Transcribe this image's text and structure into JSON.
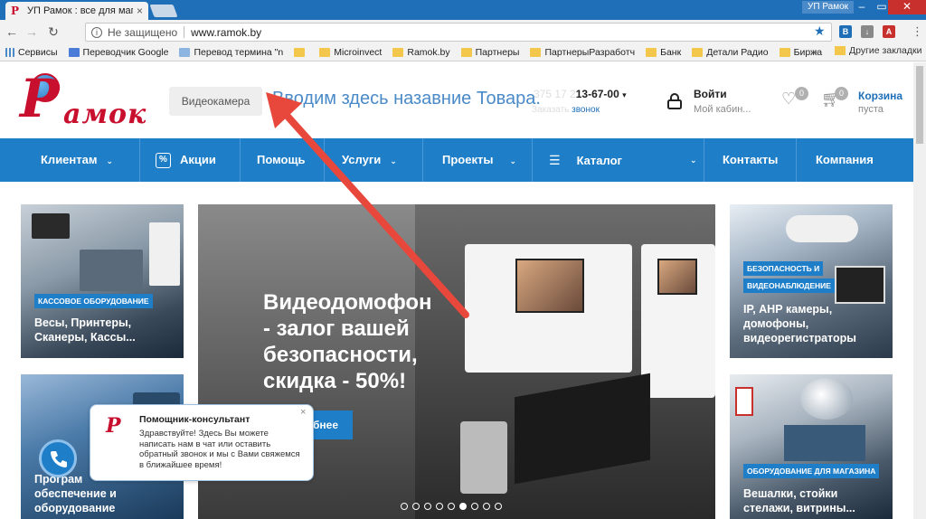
{
  "browser": {
    "tab_title": "УП Рамок : все для магаз",
    "tab_close": "×",
    "user_badge": "УП Рамок",
    "win_min": "‒",
    "win_max": "▭",
    "win_close": "✕",
    "back_icon": "back-arrow-icon",
    "forward_icon": "forward-arrow-icon",
    "reload_icon": "reload-icon",
    "security_label": "Не защищено",
    "url": "www.ramok.by"
  },
  "bookmarks": {
    "items": [
      {
        "label": "Сервисы",
        "icon": "apps-icon"
      },
      {
        "label": "Переводчик Google",
        "icon": "google-translate-icon"
      },
      {
        "label": "Перевод термина \"n",
        "icon": "doc-icon"
      },
      {
        "label": "",
        "icon": "folder-icon"
      },
      {
        "label": "Microinvect",
        "icon": "folder-icon"
      },
      {
        "label": "Ramok.by",
        "icon": "folder-icon"
      },
      {
        "label": "Партнеры",
        "icon": "folder-icon"
      },
      {
        "label": "ПартнерыРазработч",
        "icon": "folder-icon"
      },
      {
        "label": "Банк",
        "icon": "folder-icon"
      },
      {
        "label": "Детали Радио",
        "icon": "folder-icon"
      },
      {
        "label": "Биржа",
        "icon": "folder-icon"
      }
    ],
    "more": "»",
    "other": "Другие закладки"
  },
  "header": {
    "logo_letter": "Р",
    "logo_word": "амок",
    "search_placeholder": "Видеокамера",
    "overlay_text": "Вводим здесь назавние Товара.",
    "phone_prefix": "375 17 2",
    "phone": "13-67-00",
    "phone_chevron": "▾",
    "callback_prefix": "Заказать ",
    "callback": "звонок",
    "login_title": "Войти",
    "login_sub": "Мой кабин...",
    "favorites_count": "0",
    "cart_count": "0",
    "cart_title": "Корзина",
    "cart_status": "пуста"
  },
  "nav": {
    "items": [
      {
        "label": "Клиентам",
        "chevron": true
      },
      {
        "label": "Акции",
        "icon": "percent-icon"
      },
      {
        "label": "Помощь"
      },
      {
        "label": "Услуги",
        "chevron": true
      },
      {
        "label": "Проекты",
        "chevron": true
      },
      {
        "label": "Каталог",
        "chevron": true,
        "icon": "hamburger-icon"
      },
      {
        "label": "Контакты"
      },
      {
        "label": "Компания"
      }
    ],
    "chev": "⌄"
  },
  "tiles": {
    "left_top": {
      "tag": "КАССОВОЕ ОБОРУДОВАНИЕ",
      "caption_1": "Весы, Принтеры,",
      "caption_2": "Сканеры, Кассы..."
    },
    "left_bottom": {
      "caption_1": "Програм",
      "caption_2": "обеспечение и",
      "caption_3": "оборудование"
    },
    "right_top": {
      "tag_1": "БЕЗОПАСНОСТЬ И",
      "tag_2": "ВИДЕОНАБЛЮДЕНИЕ",
      "caption_1": "IP, АНР камеры,",
      "caption_2": "домофоны,",
      "caption_3": "видеорегистраторы"
    },
    "right_bottom": {
      "tag": "ОБОРУДОВАНИЕ ДЛЯ МАГАЗИНА",
      "caption_1": "Вешалки, стойки",
      "caption_2": "стелажи, витрины..."
    }
  },
  "hero": {
    "title_1": "Видеодомофон",
    "title_2": "- залог вашей",
    "title_3": "безопасности,",
    "title_4": "скидка - 50%!",
    "button": "бнее",
    "slide_count": 9,
    "active_slide": 6
  },
  "chat": {
    "avatar": "Р",
    "title": "Помощник-консультант",
    "body": "Здравствуйте! Здесь Вы можете написать нам в чат или оставить обратный звонок и мы с Вами свяжемся в ближайшее время!",
    "close": "×"
  },
  "colors": {
    "brand_red": "#c8102e",
    "brand_blue": "#1f7ec8",
    "chrome_blue": "#1e6fb8"
  }
}
